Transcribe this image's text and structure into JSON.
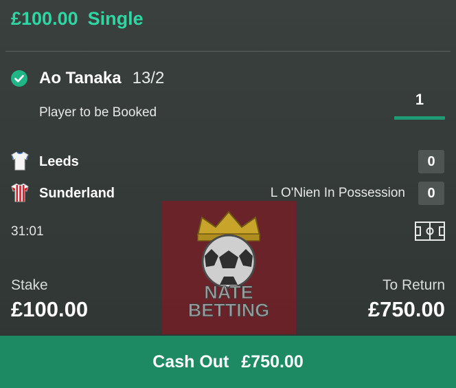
{
  "bet": {
    "amount": "£100.00",
    "type": "Single"
  },
  "selection": {
    "name": "Ao Tanaka",
    "odds": "13/2",
    "market": "Player to be Booked",
    "count": "1",
    "status_icon": "check-circle-icon"
  },
  "match": {
    "home": {
      "team": "Leeds",
      "score": "0",
      "shirt_icon": "white-shirt-icon"
    },
    "away": {
      "team": "Sunderland",
      "score": "0",
      "shirt_icon": "red-white-striped-shirt-icon"
    },
    "possession": "L O'Nien In Possession",
    "clock": "31:01",
    "pitch_icon": "pitch-icon"
  },
  "watermark": {
    "line1": "NATE",
    "line2": "BETTING"
  },
  "stake": {
    "label": "Stake",
    "value": "£100.00"
  },
  "to_return": {
    "label": "To Return",
    "value": "£750.00"
  },
  "cashout": {
    "label": "Cash Out",
    "value": "£750.00"
  },
  "colors": {
    "accent": "#2ed6a4",
    "cashout_bg": "#1d8a64",
    "background": "#353b39",
    "score_box": "#4e5553"
  }
}
